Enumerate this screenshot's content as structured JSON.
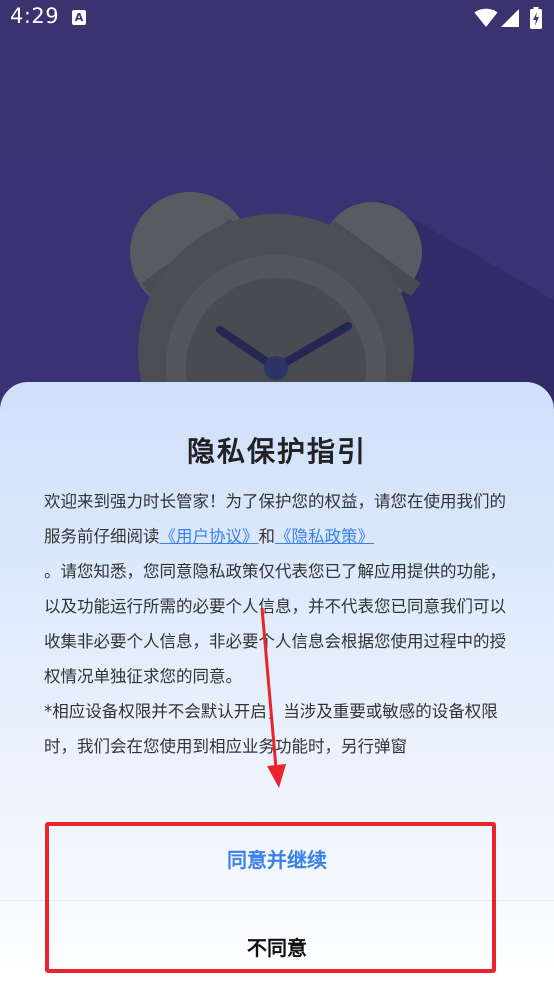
{
  "status_bar": {
    "time": "4:29",
    "notification_icon_letter": "A"
  },
  "dialog": {
    "title": "隐私保护指引",
    "paragraph1_text": "欢迎来到强力时长管家！为了保护您的权益，请您在使用我们的服务前仔细阅读",
    "user_agreement_link": "《用户协议》",
    "and_text": "和",
    "privacy_policy_link": "《隐私政策》",
    "paragraph1_tail": "。请您知悉，您同意隐私政策仅代表您已了解应用提供的功能，以及功能运行所需的必要个人信息，并不代表您已同意我们可以收集非必要个人信息，非必要个人信息会根据您使用过程中的授权情况单独征求您的同意。",
    "paragraph2_text": "*相应设备权限并不会默认开启，当涉及重要或敏感的设备权限时，我们会在您使用到相应业务功能时，另行弹窗",
    "agree_button": "同意并继续",
    "disagree_button": "不同意"
  },
  "colors": {
    "background": "#3a3370",
    "link": "#3b82e6",
    "annotation": "#e8252a"
  }
}
